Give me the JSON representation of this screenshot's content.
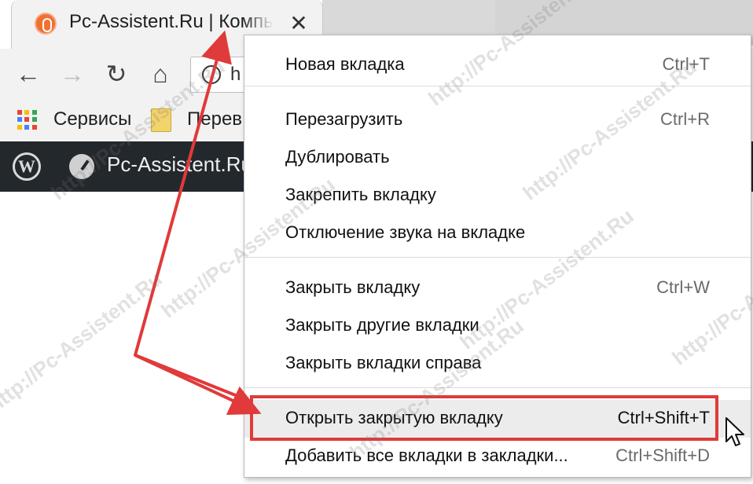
{
  "tab": {
    "title": "Pc-Assistent.Ru | Компьютерная помощь",
    "close": "✕"
  },
  "toolbar": {
    "back": "←",
    "forward": "→",
    "reload": "↻",
    "home": "⌂",
    "url_partial": "h"
  },
  "bookmarks": {
    "apps_label": "Сервисы",
    "folder_label": "Перев"
  },
  "wp_admin_bar": {
    "wp_logo": "W",
    "site_name": "Pc-Assistent.Ru"
  },
  "menu": {
    "groups": [
      [
        {
          "label": "Новая вкладка",
          "shortcut": "Ctrl+T"
        }
      ],
      [
        {
          "label": "Перезагрузить",
          "shortcut": "Ctrl+R"
        },
        {
          "label": "Дублировать",
          "shortcut": ""
        },
        {
          "label": "Закрепить вкладку",
          "shortcut": ""
        },
        {
          "label": "Отключение звука на вкладке",
          "shortcut": ""
        }
      ],
      [
        {
          "label": "Закрыть вкладку",
          "shortcut": "Ctrl+W"
        },
        {
          "label": "Закрыть другие вкладки",
          "shortcut": ""
        },
        {
          "label": "Закрыть вкладки справа",
          "shortcut": ""
        }
      ],
      [
        {
          "label": "Открыть закрытую вкладку",
          "shortcut": "Ctrl+Shift+T",
          "highlighted": true
        },
        {
          "label": "Добавить все вкладки в закладки...",
          "shortcut": "Ctrl+Shift+D"
        }
      ]
    ]
  },
  "watermark": "http://Pc-Assistent.Ru",
  "colors": {
    "annotation_red": "#e03a3a",
    "wp_bar": "#23282d",
    "favicon": "#f07132",
    "apps_icon": [
      "#ea4335",
      "#fbbc05",
      "#34a853",
      "#4285f4",
      "#ea4335",
      "#34a853",
      "#fbbc05",
      "#4285f4",
      "#ea4335"
    ]
  }
}
